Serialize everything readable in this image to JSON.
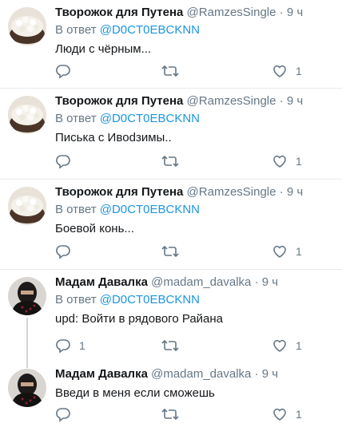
{
  "colors": {
    "accent": "#1b95e0",
    "muted": "#657786",
    "text": "#14171a",
    "border": "#e6ecf0"
  },
  "tweets": [
    {
      "name": "Творожок для Путена",
      "handle": "@RamzesSingle",
      "sep": "·",
      "time": "9 ч",
      "reply_prefix": "В ответ",
      "reply_to": "@D0CT0EBCKNN",
      "text": "Люди с чёрным...",
      "reply_count": "",
      "like_count": "1",
      "avatar": "rice-bowl"
    },
    {
      "name": "Творожок для Путена",
      "handle": "@RamzesSingle",
      "sep": "·",
      "time": "9 ч",
      "reply_prefix": "В ответ",
      "reply_to": "@D0CT0EBCKNN",
      "text": "Писька с Ивodзимы..",
      "reply_count": "",
      "like_count": "1",
      "avatar": "rice-bowl"
    },
    {
      "name": "Творожок для Путена",
      "handle": "@RamzesSingle",
      "sep": "·",
      "time": "9 ч",
      "reply_prefix": "В ответ",
      "reply_to": "@D0CT0EBCKNN",
      "text": "Боевой конь...",
      "reply_count": "",
      "like_count": "1",
      "avatar": "rice-bowl"
    },
    {
      "name": "Мадам Давалка",
      "handle": "@madam_davalka",
      "sep": "·",
      "time": "9 ч",
      "reply_prefix": "В ответ",
      "reply_to": "@D0CT0EBCKNN",
      "text": "upd: Войти в рядового Райана",
      "reply_count": "1",
      "like_count": "1",
      "avatar": "veiled-person"
    },
    {
      "name": "Мадам Давалка",
      "handle": "@madam_davalka",
      "sep": "·",
      "time": "9 ч",
      "reply_prefix": "",
      "reply_to": "",
      "text": "Введи в меня если сможешь",
      "reply_count": "",
      "like_count": "1",
      "avatar": "veiled-person"
    }
  ]
}
